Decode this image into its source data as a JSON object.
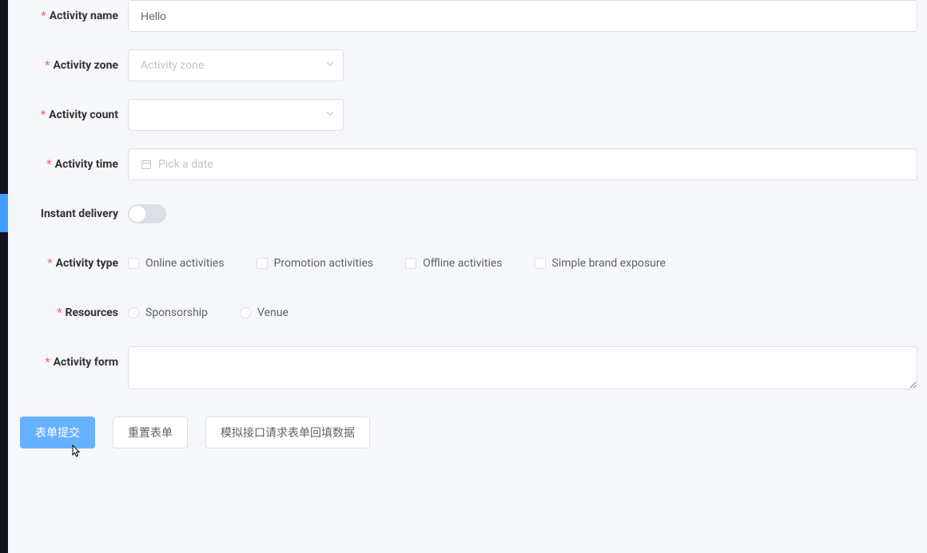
{
  "form": {
    "fields": {
      "activityName": {
        "label": "Activity name",
        "value": "Hello"
      },
      "activityZone": {
        "label": "Activity zone",
        "placeholder": "Activity zone"
      },
      "activityCount": {
        "label": "Activity count",
        "placeholder": ""
      },
      "activityTime": {
        "label": "Activity time",
        "placeholder": "Pick a date"
      },
      "instantDelivery": {
        "label": "Instant delivery",
        "value": false
      },
      "activityType": {
        "label": "Activity type",
        "options": [
          "Online activities",
          "Promotion activities",
          "Offline activities",
          "Simple brand exposure"
        ]
      },
      "resources": {
        "label": "Resources",
        "options": [
          "Sponsorship",
          "Venue"
        ]
      },
      "activityForm": {
        "label": "Activity form",
        "value": ""
      }
    },
    "buttons": {
      "submit": "表单提交",
      "reset": "重置表单",
      "mock": "模拟接口请求表单回填数据"
    }
  }
}
